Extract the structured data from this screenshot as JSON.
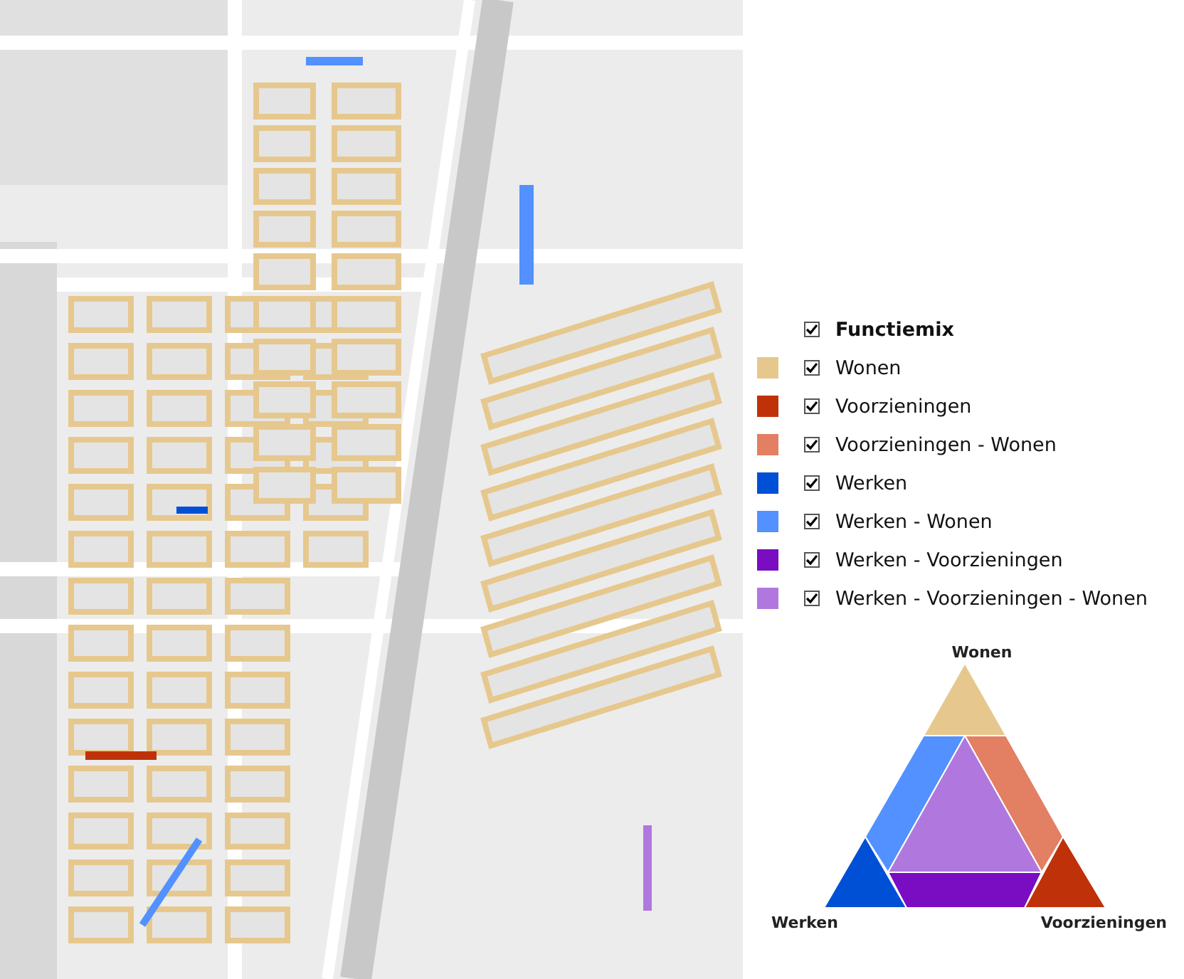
{
  "legend": {
    "title": "Functiemix",
    "title_checked": true,
    "items": [
      {
        "label": "Wonen",
        "checked": true,
        "color": "#e6c88e"
      },
      {
        "label": "Voorzieningen",
        "checked": true,
        "color": "#bf3209"
      },
      {
        "label": "Voorzieningen - Wonen",
        "checked": true,
        "color": "#e37f62"
      },
      {
        "label": "Werken",
        "checked": true,
        "color": "#0050d6"
      },
      {
        "label": "Werken - Wonen",
        "checked": true,
        "color": "#5291ff"
      },
      {
        "label": "Werken - Voorzieningen",
        "checked": true,
        "color": "#7a0cc2"
      },
      {
        "label": "Werken - Voorzieningen - Wonen",
        "checked": true,
        "color": "#b078df"
      }
    ]
  },
  "triangle": {
    "top_label": "Wonen",
    "left_label": "Werken",
    "right_label": "Voorzieningen"
  }
}
